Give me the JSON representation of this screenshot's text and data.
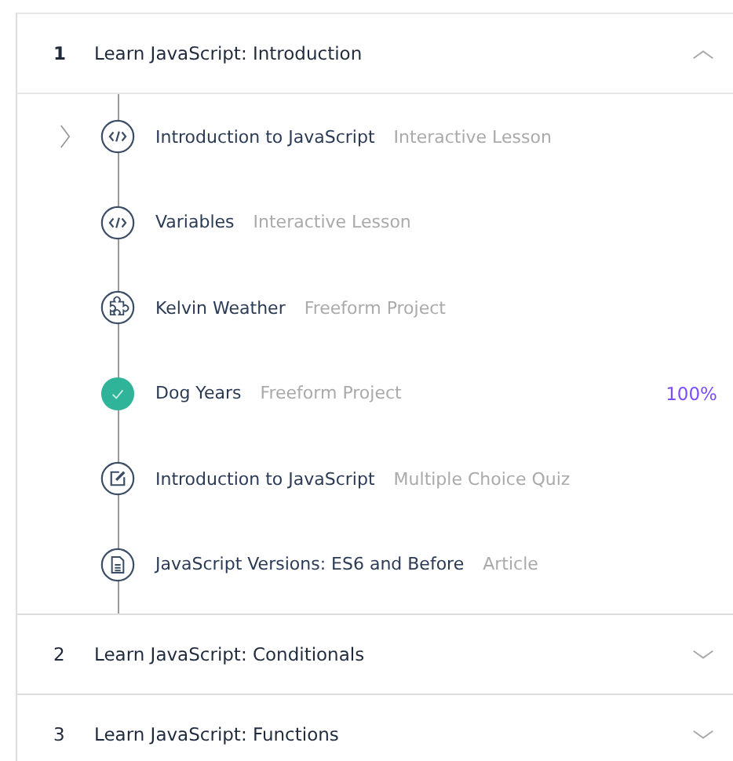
{
  "sections": [
    {
      "number": "1",
      "title": "Learn JavaScript: Introduction",
      "expanded": true,
      "lessons": [
        {
          "title": "Introduction to JavaScript",
          "type": "Interactive Lesson",
          "kind": "code",
          "completed": false,
          "current": true
        },
        {
          "title": "Variables",
          "type": "Interactive Lesson",
          "kind": "code",
          "completed": false,
          "current": false
        },
        {
          "title": "Kelvin Weather",
          "type": "Freeform Project",
          "kind": "project",
          "completed": false,
          "current": false
        },
        {
          "title": "Dog Years",
          "type": "Freeform Project",
          "completed": true,
          "current": false,
          "progress": "100%"
        },
        {
          "title": "Introduction to JavaScript",
          "type": "Multiple Choice Quiz",
          "kind": "quiz",
          "completed": false,
          "current": false
        },
        {
          "title": "JavaScript Versions: ES6 and Before",
          "type": "Article",
          "kind": "article",
          "completed": false,
          "current": false
        }
      ]
    },
    {
      "number": "2",
      "title": "Learn JavaScript: Conditionals",
      "expanded": false
    },
    {
      "number": "3",
      "title": "Learn JavaScript: Functions",
      "expanded": false
    }
  ]
}
